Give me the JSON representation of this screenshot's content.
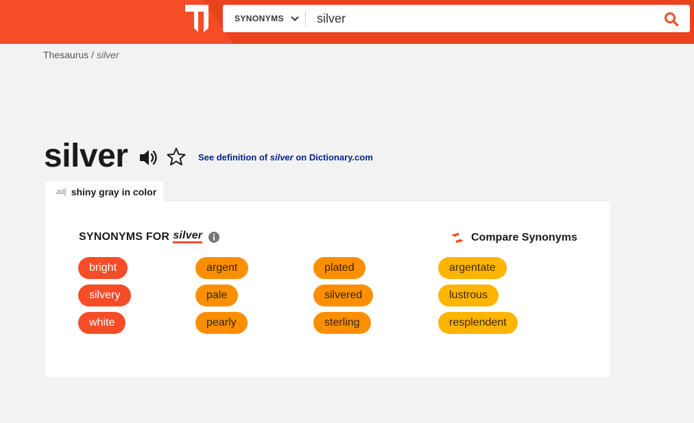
{
  "header": {
    "logo_icon": "thesaurus-t-logo-icon",
    "search_mode": "SYNONYMS",
    "search_value": "silver",
    "search_icon": "search-icon",
    "brand_color": "#f64c27"
  },
  "breadcrumb": {
    "root": "Thesaurus",
    "separator": " / ",
    "current": "silver"
  },
  "word": {
    "headword": "silver",
    "definition_link": {
      "prefix": "See definition of ",
      "word": "silver",
      "suffix": " on Dictionary.com"
    }
  },
  "sense": {
    "pos": "adj",
    "definition": "shiny gray in color"
  },
  "synonyms": {
    "heading_prefix": "SYNONYMS FOR",
    "heading_word": "silver",
    "compare_label": "Compare Synonyms",
    "colors": {
      "strongest": "#f64c27",
      "strong": "#fc8f00",
      "weak": "#ffb400"
    },
    "columns": [
      [
        "bright",
        "silvery",
        "white"
      ],
      [
        "argent",
        "pale",
        "pearly"
      ],
      [
        "plated",
        "silvered",
        "sterling"
      ],
      [
        "argentate",
        "lustrous",
        "resplendent"
      ]
    ]
  }
}
